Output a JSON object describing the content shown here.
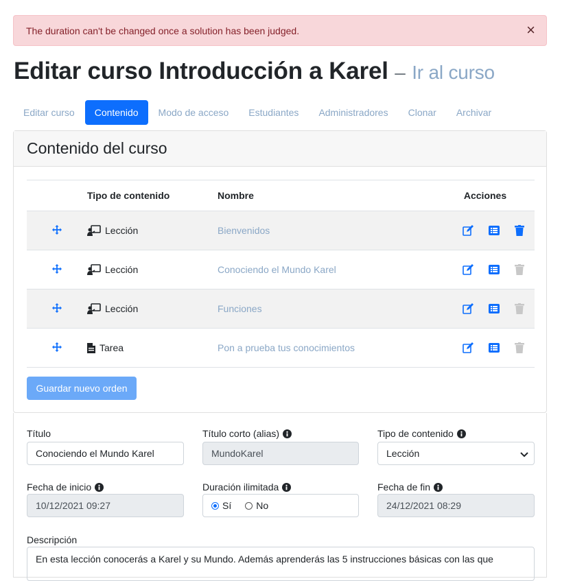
{
  "alert": {
    "message": "The duration can't be changed once a solution has been judged.",
    "close": "×"
  },
  "page": {
    "title": "Editar curso Introducción a Karel",
    "dash": "–",
    "go_link": "Ir al curso"
  },
  "tabs": [
    {
      "label": "Editar curso",
      "active": false
    },
    {
      "label": "Contenido",
      "active": true
    },
    {
      "label": "Modo de acceso",
      "active": false
    },
    {
      "label": "Estudiantes",
      "active": false
    },
    {
      "label": "Administradores",
      "active": false
    },
    {
      "label": "Clonar",
      "active": false
    },
    {
      "label": "Archivar",
      "active": false
    }
  ],
  "content": {
    "header": "Contenido del curso",
    "columns": {
      "type": "Tipo de contenido",
      "name": "Nombre",
      "actions": "Acciones"
    },
    "rows": [
      {
        "type": "Lección",
        "type_icon": "lesson-icon",
        "name": "Bienvenidos",
        "delete_enabled": true
      },
      {
        "type": "Lección",
        "type_icon": "lesson-icon",
        "name": "Conociendo el Mundo Karel",
        "delete_enabled": false
      },
      {
        "type": "Lección",
        "type_icon": "lesson-icon",
        "name": "Funciones",
        "delete_enabled": false
      },
      {
        "type": "Tarea",
        "type_icon": "assignment-icon",
        "name": "Pon a prueba tus conocimientos",
        "delete_enabled": false
      }
    ],
    "save_order": "Guardar nuevo orden"
  },
  "form": {
    "title_label": "Título",
    "title_value": "Conociendo el Mundo Karel",
    "alias_label": "Título corto (alias)",
    "alias_value": "MundoKarel",
    "content_type_label": "Tipo de contenido",
    "content_type_value": "Lección",
    "start_label": "Fecha de inicio",
    "start_value": "10/12/2021 09:27",
    "unlimited_label": "Duración ilimitada",
    "unlimited_yes": "Sí",
    "unlimited_no": "No",
    "end_label": "Fecha de fin",
    "end_value": "24/12/2021 08:29",
    "desc_label": "Descripción",
    "desc_value": "En esta lección conocerás a Karel y su Mundo. Además aprenderás las 5 instrucciones básicas con las que"
  },
  "colors": {
    "primary": "#0d6efd",
    "link": "#8aa7c6",
    "alert_bg": "#f8d7da",
    "alert_text": "#842029"
  }
}
